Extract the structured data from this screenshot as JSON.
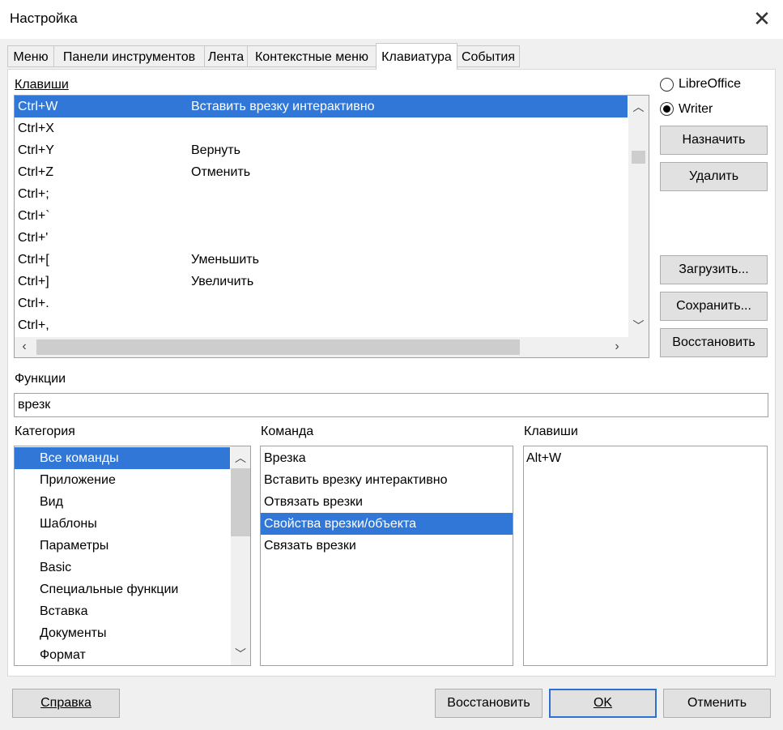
{
  "window": {
    "title": "Настройка",
    "close_glyph": "✕"
  },
  "tabs": [
    {
      "label": "Меню"
    },
    {
      "label": "Панели инструментов"
    },
    {
      "label": "Лента"
    },
    {
      "label": "Контекстные меню"
    },
    {
      "label": "Клавиатура",
      "active": true
    },
    {
      "label": "События"
    }
  ],
  "keys_section": {
    "label": "Клавиши",
    "rows": [
      {
        "key": "Ctrl+W",
        "func": "Вставить врезку интерактивно",
        "selected": true
      },
      {
        "key": "Ctrl+X",
        "func": ""
      },
      {
        "key": "Ctrl+Y",
        "func": "Вернуть"
      },
      {
        "key": "Ctrl+Z",
        "func": "Отменить"
      },
      {
        "key": "Ctrl+;",
        "func": ""
      },
      {
        "key": "Ctrl+`",
        "func": ""
      },
      {
        "key": "Ctrl+'",
        "func": ""
      },
      {
        "key": "Ctrl+[",
        "func": "Уменьшить"
      },
      {
        "key": "Ctrl+]",
        "func": "Увеличить"
      },
      {
        "key": "Ctrl+.",
        "func": ""
      },
      {
        "key": "Ctrl+,",
        "func": ""
      }
    ]
  },
  "scope": {
    "options": [
      {
        "label": "LibreOffice",
        "checked": false
      },
      {
        "label": "Writer",
        "checked": true
      }
    ]
  },
  "side_buttons": {
    "assign": "Назначить",
    "delete": "Удалить",
    "load": "Загрузить...",
    "save": "Сохранить...",
    "reset": "Восстановить"
  },
  "functions": {
    "label": "Функции",
    "search_value": "врезк"
  },
  "category": {
    "label": "Категория",
    "items": [
      {
        "label": "Все команды",
        "selected": true
      },
      {
        "label": "Приложение"
      },
      {
        "label": "Вид"
      },
      {
        "label": "Шаблоны"
      },
      {
        "label": "Параметры"
      },
      {
        "label": "Basic"
      },
      {
        "label": "Специальные функции"
      },
      {
        "label": "Вставка"
      },
      {
        "label": "Документы"
      },
      {
        "label": "Формат"
      }
    ]
  },
  "command": {
    "label": "Команда",
    "items": [
      {
        "label": "Врезка"
      },
      {
        "label": "Вставить врезку интерактивно"
      },
      {
        "label": "Отвязать врезки"
      },
      {
        "label": "Свойства врезки/объекта",
        "selected": true
      },
      {
        "label": "Связать врезки"
      }
    ]
  },
  "cmd_keys": {
    "label": "Клавиши",
    "items": [
      {
        "label": "Alt+W"
      }
    ]
  },
  "footer": {
    "help": "Справка",
    "reset": "Восстановить",
    "ok": "OK",
    "cancel": "Отменить"
  },
  "colors": {
    "selection": "#3077d8",
    "default_button_border": "#2e6fd0"
  }
}
